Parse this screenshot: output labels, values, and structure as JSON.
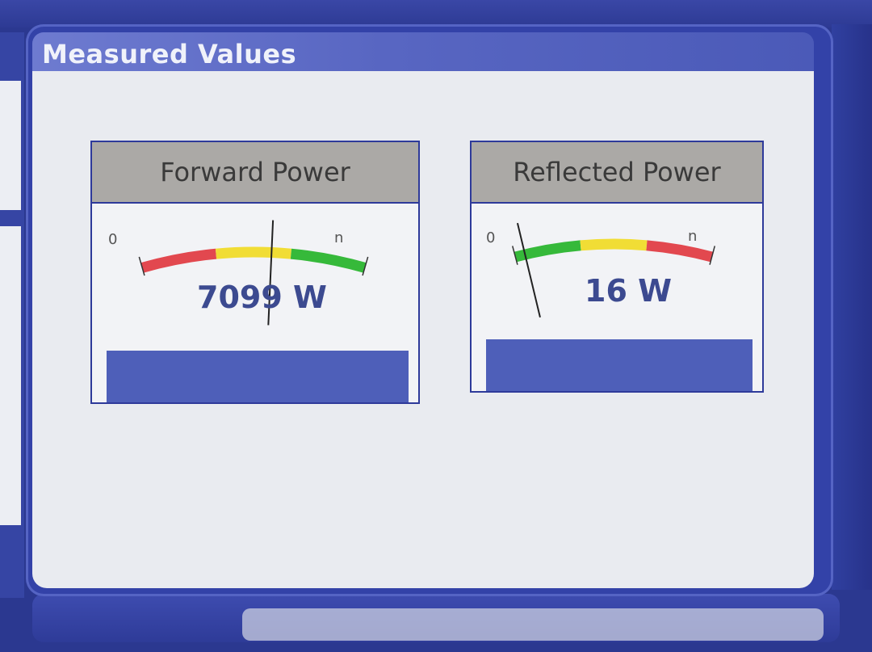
{
  "window": {
    "title": "Measured Values"
  },
  "meters": [
    {
      "id": "forward",
      "label": "Forward Power",
      "value_text": "7099 W",
      "scale_min_label": "0",
      "scale_max_label": "n",
      "needle_fraction": 0.58,
      "bands": [
        "red",
        "yellow",
        "green"
      ]
    },
    {
      "id": "reflected",
      "label": "Reflected Power",
      "value_text": "16 W",
      "scale_min_label": "0",
      "scale_max_label": "n",
      "needle_fraction": 0.05,
      "bands": [
        "green",
        "yellow",
        "red"
      ]
    }
  ],
  "colors": {
    "red": "#e2484f",
    "yellow": "#f1dd35",
    "green": "#36b93a",
    "panel_blue": "#3342a8",
    "header_gray": "#aba9a6",
    "value_blue": "#3c4a90"
  }
}
